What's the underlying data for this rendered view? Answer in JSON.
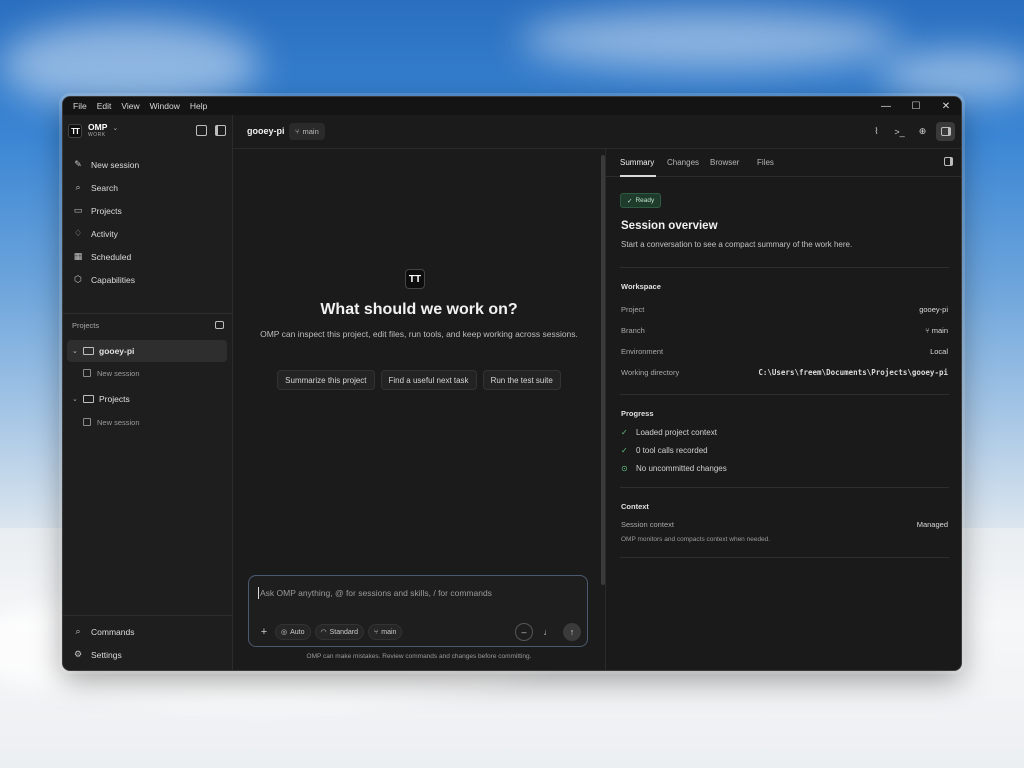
{
  "menubar": {
    "items": [
      "File",
      "Edit",
      "View",
      "Window",
      "Help"
    ],
    "controls": {
      "minimize": "—",
      "maximize": "☐",
      "close": "✕"
    }
  },
  "sidebar": {
    "brand": {
      "name": "OMP",
      "sub": "WORK",
      "logo": "TT"
    },
    "nav": [
      {
        "icon": "new-session-icon",
        "glyph": "✎",
        "label": "New session"
      },
      {
        "icon": "search-icon",
        "glyph": "⌕",
        "label": "Search"
      },
      {
        "icon": "folder-icon",
        "glyph": "▭",
        "label": "Projects"
      },
      {
        "icon": "bell-icon",
        "glyph": "♢",
        "label": "Activity"
      },
      {
        "icon": "calendar-icon",
        "glyph": "▦",
        "label": "Scheduled"
      },
      {
        "icon": "cube-icon",
        "glyph": "⬡",
        "label": "Capabilities"
      }
    ],
    "projects_header": "Projects",
    "projects": [
      {
        "name": "gooey-pi",
        "session": "New session"
      },
      {
        "name": "Projects",
        "session": "New session"
      }
    ],
    "bottom": [
      {
        "icon": "search-icon",
        "glyph": "⌕",
        "label": "Commands"
      },
      {
        "icon": "gear-icon",
        "glyph": "⚙",
        "label": "Settings"
      }
    ]
  },
  "topbar": {
    "title": "gooey-pi",
    "branch": "main"
  },
  "center": {
    "logo": "TT",
    "heading": "What should we work on?",
    "subtitle": "OMP can inspect this project, edit files, run tools, and keep working across sessions.",
    "suggestions": [
      "Summarize this project",
      "Find a useful next task",
      "Run the test suite"
    ],
    "composer": {
      "placeholder": "Ask OMP anything, @ for sessions and skills, / for commands",
      "mode": "Auto",
      "level": "Standard",
      "branch": "main"
    },
    "disclaimer": "OMP can make mistakes. Review commands and changes before committing."
  },
  "panel": {
    "tabs": [
      "Summary",
      "Changes",
      "Browser",
      "Files"
    ],
    "status": "Ready",
    "title": "Session overview",
    "subtitle": "Start a conversation to see a compact summary of the work here.",
    "workspace": {
      "heading": "Workspace",
      "rows": [
        {
          "k": "Project",
          "v": "gooey-pi"
        },
        {
          "k": "Branch",
          "v": "main"
        },
        {
          "k": "Environment",
          "v": "Local"
        },
        {
          "k": "Working directory",
          "v": "C:\\Users\\freem\\Documents\\Projects\\gooey-pi"
        }
      ]
    },
    "progress": {
      "heading": "Progress",
      "items": [
        "Loaded project context",
        "0 tool calls recorded",
        "No uncommitted changes"
      ]
    },
    "context": {
      "heading": "Context",
      "k": "Session context",
      "v": "Managed",
      "note": "OMP monitors and compacts context when needed."
    }
  },
  "colors": {
    "accent_green": "#5ec285",
    "background": "#1b1b1b",
    "composer_border": "#4a5a70"
  }
}
